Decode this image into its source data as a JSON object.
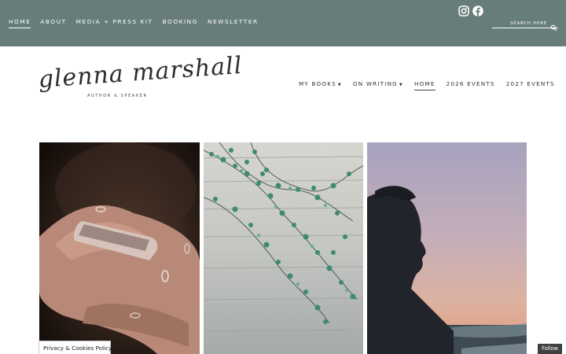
{
  "topbar": {
    "nav": [
      {
        "label": "HOME",
        "active": true
      },
      {
        "label": "ABOUT",
        "active": false
      },
      {
        "label": "MEDIA + PRESS KIT",
        "active": false
      },
      {
        "label": "BOOKING",
        "active": false
      },
      {
        "label": "NEWSLETTER",
        "active": false
      }
    ],
    "social_icons": [
      "instagram-icon",
      "facebook-icon"
    ],
    "search": {
      "placeholder": "SEARCH HERE",
      "value": ""
    },
    "background_color": "#667d79"
  },
  "header": {
    "logo_name": "glenna marshall",
    "logo_tagline": "AUTHOR & SPEAKER",
    "nav": [
      {
        "label": "MY BOOKS",
        "dropdown": true,
        "active": false
      },
      {
        "label": "ON WRITING",
        "dropdown": true,
        "active": false
      },
      {
        "label": "HOME",
        "dropdown": false,
        "active": true
      },
      {
        "label": "2026 EVENTS",
        "dropdown": false,
        "active": false
      },
      {
        "label": "2027 EVENTS",
        "dropdown": false,
        "active": false
      }
    ]
  },
  "gallery": {
    "images": [
      "hands-holding-phone-photo",
      "ivy-on-wood-wall-photo",
      "woman-silhouette-sunset-photo"
    ]
  },
  "footer": {
    "privacy_label": "Privacy & Cookies Policy",
    "follow_label": "Follow"
  }
}
